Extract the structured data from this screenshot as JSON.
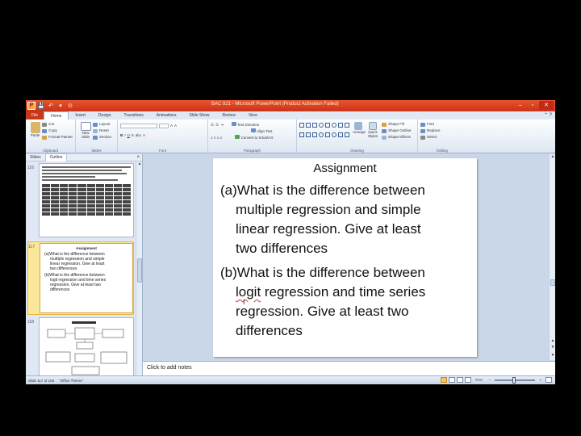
{
  "window": {
    "title": "BAC 821 - Microsoft PowerPoint (Product Activation Failed)",
    "qat": [
      "P",
      "💾",
      "↶",
      "▾",
      "⊙"
    ],
    "controls": [
      "–",
      "▫",
      "✕"
    ]
  },
  "ribbon_tabs": [
    "File",
    "Home",
    "Insert",
    "Design",
    "Transitions",
    "Animations",
    "Slide Show",
    "Review",
    "View"
  ],
  "ribbon": {
    "clipboard": {
      "paste": "Paste",
      "cut": "Cut",
      "copy": "Copy",
      "format_painter": "Format Painter",
      "label": "Clipboard"
    },
    "slides": {
      "new_slide": "New Slide",
      "layout": "Layout",
      "reset": "Reset",
      "section": "Section",
      "label": "Slides"
    },
    "font": {
      "label": "Font"
    },
    "paragraph": {
      "text_direction": "Text Direction",
      "align_text": "Align Text",
      "smartart": "Convert to SmartArt",
      "label": "Paragraph"
    },
    "drawing": {
      "arrange": "Arrange",
      "quick_styles": "Quick Styles",
      "shape_fill": "Shape Fill",
      "shape_outline": "Shape Outline",
      "shape_effects": "Shape Effects",
      "label": "Drawing"
    },
    "editing": {
      "find": "Find",
      "replace": "Replace",
      "select": "Select",
      "label": "Editing"
    }
  },
  "left_pane": {
    "tabs": [
      "Slides",
      "Outline"
    ],
    "close": "×",
    "thumbnails": [
      {
        "num": "116"
      },
      {
        "num": "117",
        "title": "Assignment",
        "lines": [
          "(a)What is the difference between",
          "multiple regression and simple",
          "linear regression. Give at least",
          "two differences",
          "(b)What is the difference between",
          "logit regression and time series",
          "regression. Give at least two",
          "differences"
        ]
      },
      {
        "num": "118"
      }
    ]
  },
  "slide": {
    "title": "Assignment",
    "a_line1": "(a)What is the difference between",
    "a_line2": "multiple regression and simple",
    "a_line3": "linear regression. Give at least",
    "a_line4": "two differences",
    "b_line1": "(b)What is the difference between",
    "b_word_logit": "logit",
    "b_line2_rest": " regression and time series",
    "b_line3_start": "r",
    "b_line3_squig": "egression",
    "b_line3_rest": ". Give at least two",
    "b_line4": "differences",
    "cursor": "I"
  },
  "notes": {
    "placeholder": "Click to add notes"
  },
  "status": {
    "slide_info": "Slide 117 of 165",
    "theme": "\"Office Theme\"",
    "zoom": "71%"
  }
}
